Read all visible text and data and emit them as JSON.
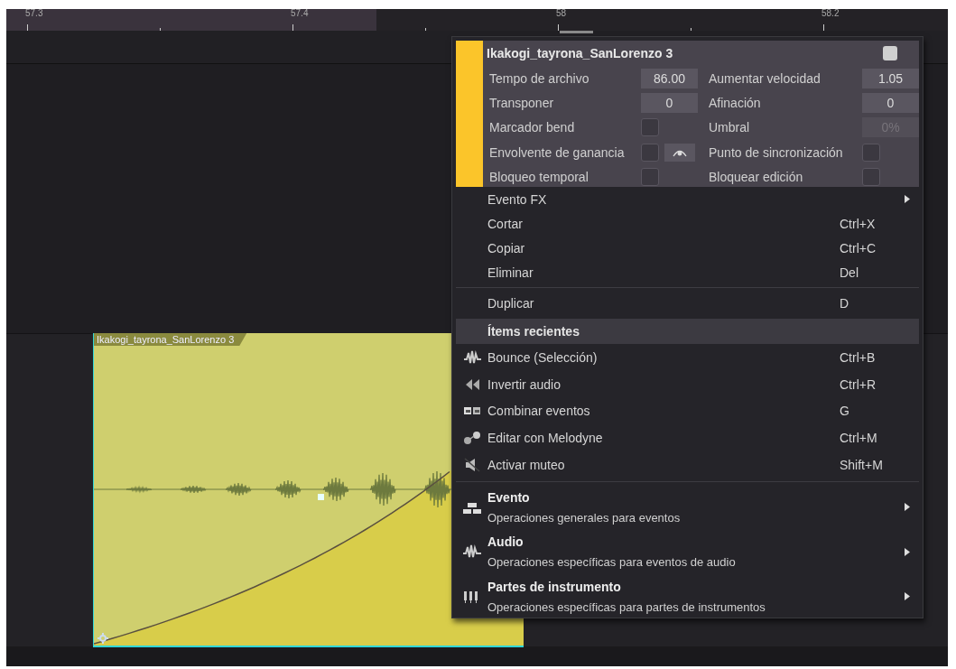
{
  "ruler": {
    "labels": [
      "57.3",
      "57.4",
      "58",
      "58.2"
    ]
  },
  "event": {
    "title": "Ikakogi_tayrona_SanLorenzo 3",
    "selected": true
  },
  "context_menu": {
    "header": {
      "title": "Ikakogi_tayrona_SanLorenzo 3",
      "color": "#fbc52a",
      "checked": true,
      "fields": [
        {
          "label": "Tempo de archivo",
          "kind": "number",
          "value": "86.00",
          "disabled": false
        },
        {
          "label": "Aumentar velocidad",
          "kind": "number",
          "value": "1.05",
          "disabled": false
        },
        {
          "label": "Transponer",
          "kind": "number",
          "value": "0",
          "disabled": false
        },
        {
          "label": "Afinación",
          "kind": "number",
          "value": "0",
          "disabled": false
        },
        {
          "label": "Marcador bend",
          "kind": "checkbox",
          "checked": false
        },
        {
          "label": "Umbral",
          "kind": "number",
          "value": "0%",
          "disabled": true
        },
        {
          "label": "Envolvente de ganancia",
          "kind": "checkbox",
          "checked": false,
          "curve_button": true
        },
        {
          "label": "Punto de sincronización",
          "kind": "checkbox",
          "checked": false
        },
        {
          "label": "Bloqueo temporal",
          "kind": "checkbox",
          "checked": false
        },
        {
          "label": "Bloquear edición",
          "kind": "checkbox",
          "checked": false
        }
      ]
    },
    "items": [
      {
        "kind": "submenu",
        "label": "Evento FX"
      },
      {
        "kind": "command",
        "label": "Cortar",
        "shortcut": "Ctrl+X"
      },
      {
        "kind": "command",
        "label": "Copiar",
        "shortcut": "Ctrl+C"
      },
      {
        "kind": "command",
        "label": "Eliminar",
        "shortcut": "Del"
      },
      {
        "kind": "separator"
      },
      {
        "kind": "command",
        "label": "Duplicar",
        "shortcut": "D"
      },
      {
        "kind": "heading",
        "label": "Ítems recientes"
      },
      {
        "kind": "icon_command",
        "label": "Bounce (Selección)",
        "shortcut": "Ctrl+B"
      },
      {
        "kind": "icon_command",
        "label": "Invertir audio",
        "shortcut": "Ctrl+R"
      },
      {
        "kind": "icon_command",
        "label": "Combinar eventos",
        "shortcut": "G"
      },
      {
        "kind": "icon_command",
        "label": "Editar con Melodyne",
        "shortcut": "Ctrl+M"
      },
      {
        "kind": "icon_command",
        "label": "Activar muteo",
        "shortcut": "Shift+M"
      },
      {
        "kind": "separator"
      },
      {
        "kind": "group",
        "label": "Evento",
        "description": "Operaciones generales para eventos"
      },
      {
        "kind": "group",
        "label": "Audio",
        "description": "Operaciones específicas para eventos de audio"
      },
      {
        "kind": "group",
        "label": "Partes de instrumento",
        "description": "Operaciones específicas para partes de instrumentos"
      }
    ]
  }
}
